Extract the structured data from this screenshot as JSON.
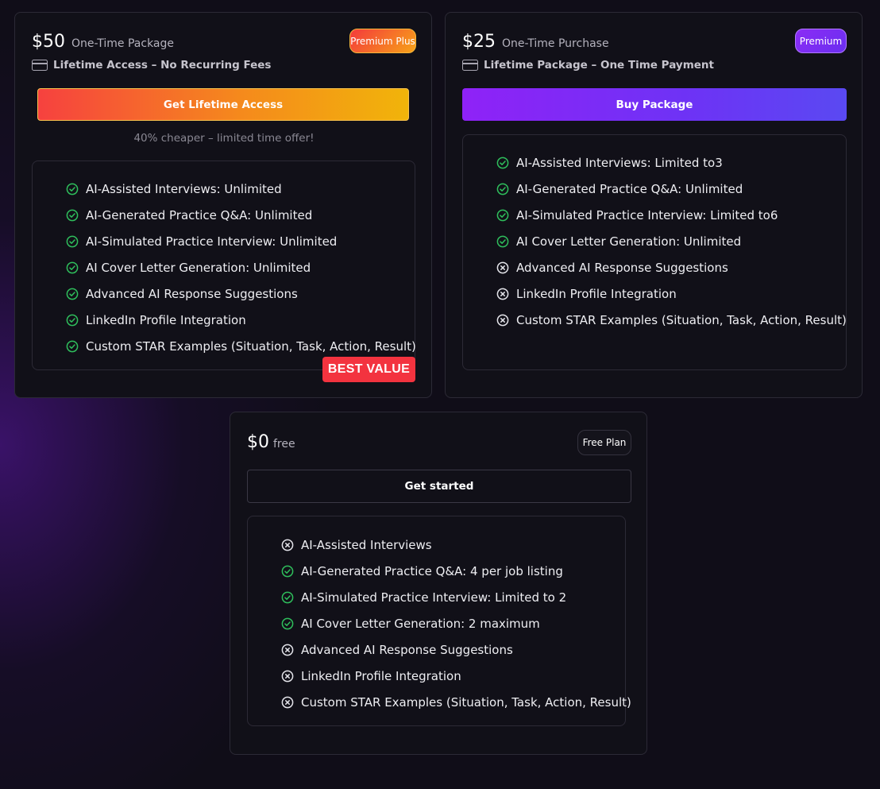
{
  "plans": {
    "lifetime": {
      "price": "$50",
      "price_note": "One-Time Package",
      "subline": "Lifetime Access – No Recurring Fees",
      "badge": "Premium Plus",
      "cta_label": "Get Lifetime Access",
      "offer_note": "40% cheaper – limited time offer!",
      "ribbon": "BEST VALUE",
      "features": [
        {
          "label": "AI-Assisted Interviews: Unlimited",
          "included": true
        },
        {
          "label": "AI-Generated Practice Q&A: Unlimited",
          "included": true
        },
        {
          "label": "AI-Simulated Practice Interview: Unlimited",
          "included": true
        },
        {
          "label": "AI Cover Letter Generation: Unlimited",
          "included": true
        },
        {
          "label": "Advanced AI Response Suggestions",
          "included": true
        },
        {
          "label": "LinkedIn Profile Integration",
          "included": true
        },
        {
          "label": "Custom STAR Examples (Situation, Task, Action, Result)",
          "included": true
        }
      ]
    },
    "premium": {
      "price": "$25",
      "price_note": "One-Time Purchase",
      "subline": "Lifetime Package – One Time Payment",
      "badge": "Premium",
      "cta_label": "Buy Package",
      "features": [
        {
          "label": "AI-Assisted Interviews: Limited to3",
          "included": true
        },
        {
          "label": "AI-Generated Practice Q&A: Unlimited",
          "included": true
        },
        {
          "label": "AI-Simulated Practice Interview: Limited to6",
          "included": true
        },
        {
          "label": "AI Cover Letter Generation: Unlimited",
          "included": true
        },
        {
          "label": "Advanced AI Response Suggestions",
          "included": false
        },
        {
          "label": "LinkedIn Profile Integration",
          "included": false
        },
        {
          "label": "Custom STAR Examples (Situation, Task, Action, Result)",
          "included": false
        }
      ]
    },
    "free": {
      "price": "$0",
      "price_note": "free",
      "badge": "Free Plan",
      "cta_label": "Get started",
      "features": [
        {
          "label": "AI-Assisted Interviews",
          "included": false
        },
        {
          "label": "AI-Generated Practice Q&A: 4 per job listing",
          "included": true
        },
        {
          "label": "AI-Simulated Practice Interview: Limited to 2",
          "included": true
        },
        {
          "label": "AI Cover Letter Generation: 2 maximum",
          "included": true
        },
        {
          "label": "Advanced AI Response Suggestions",
          "included": false
        },
        {
          "label": "LinkedIn Profile Integration",
          "included": false
        },
        {
          "label": "Custom STAR Examples (Situation, Task, Action, Result)",
          "included": false
        }
      ]
    }
  },
  "icons": {
    "included": "check-circle-icon",
    "excluded": "x-circle-icon",
    "payment": "credit-card-icon"
  },
  "colors": {
    "check": "#2fbf5c",
    "cross": "#e4e4ea",
    "premium_plus_start": "#f43a3c",
    "premium_plus_end": "#f1b40a",
    "premium_start": "#8f22f7",
    "premium_end": "#5a49f2",
    "best_value": "#f3333f"
  }
}
